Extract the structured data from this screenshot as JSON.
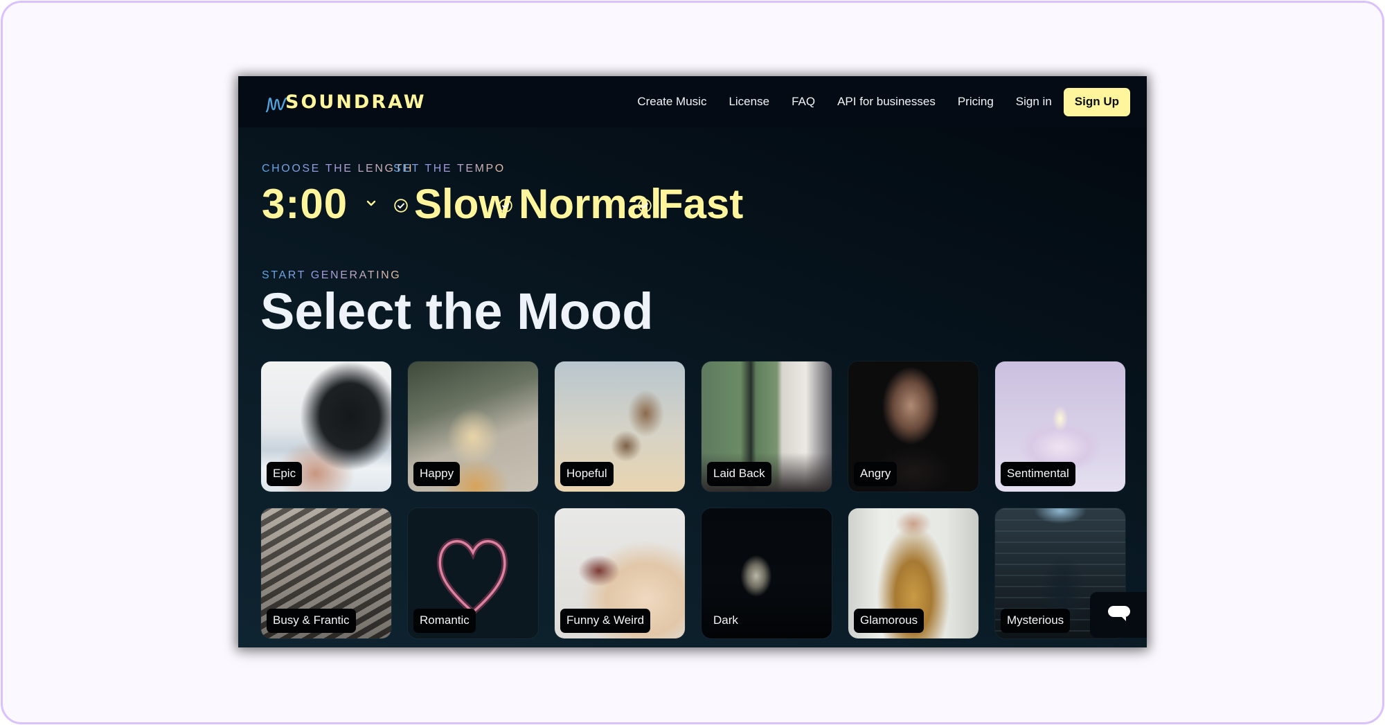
{
  "brand": {
    "name": "SOUNDRAW",
    "logo_icon": "waveform-squiggle-icon",
    "accent_color": "#fff59c",
    "wave_color": "#4fa3dc"
  },
  "nav": {
    "links": [
      {
        "label": "Create Music"
      },
      {
        "label": "License"
      },
      {
        "label": "FAQ"
      },
      {
        "label": "API for businesses"
      },
      {
        "label": "Pricing"
      },
      {
        "label": "Sign in"
      }
    ],
    "signup_label": "Sign Up"
  },
  "length": {
    "label": "CHOOSE THE LENGTH",
    "value": "3:00",
    "icon": "chevron-down-icon"
  },
  "tempo": {
    "label": "SET THE TEMPO",
    "options": [
      {
        "label": "Slow",
        "checked": true
      },
      {
        "label": "Normal",
        "checked": true
      },
      {
        "label": "Fast",
        "checked": true
      }
    ]
  },
  "mood": {
    "eyebrow": "START GENERATING",
    "title": "Select the Mood",
    "cards": [
      {
        "label": "Epic",
        "image": "bird-on-hand-mountains"
      },
      {
        "label": "Happy",
        "image": "smiling-blonde-woman-sunlight"
      },
      {
        "label": "Hopeful",
        "image": "seagulls-flying-sky"
      },
      {
        "label": "Laid Back",
        "image": "man-relaxing-by-window"
      },
      {
        "label": "Angry",
        "image": "angry-bald-bearded-man"
      },
      {
        "label": "Sentimental",
        "image": "candle-with-bokeh"
      },
      {
        "label": "Busy & Frantic",
        "image": "crowd-on-stairs-bw"
      },
      {
        "label": "Romantic",
        "image": "sparkler-heart"
      },
      {
        "label": "Funny & Weird",
        "image": "laughing-horse"
      },
      {
        "label": "Dark",
        "image": "skull-in-dark"
      },
      {
        "label": "Glamorous",
        "image": "woman-in-gold-dress"
      },
      {
        "label": "Mysterious",
        "image": "hooded-figure-brick-wall"
      }
    ]
  },
  "chat": {
    "icon": "chat-bubble-icon"
  }
}
